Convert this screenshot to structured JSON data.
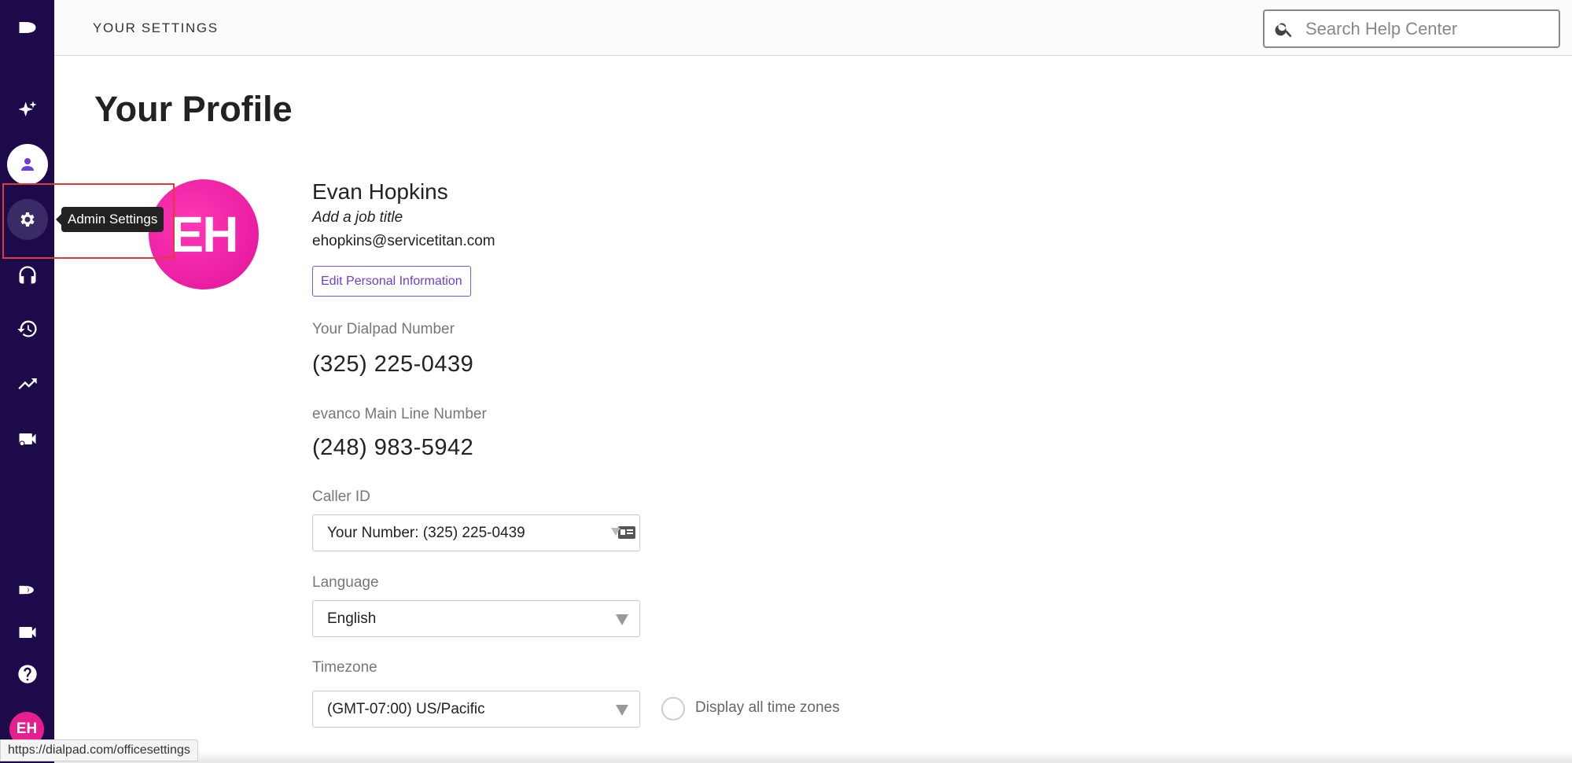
{
  "header": {
    "title": "YOUR SETTINGS",
    "search_placeholder": "Search Help Center"
  },
  "sidebar": {
    "tooltip": "Admin Settings",
    "avatar_initials": "EH",
    "items": [
      "sparkle-icon",
      "person-icon",
      "gear-icon",
      "headset-icon",
      "history-icon",
      "trending-icon",
      "video-icon",
      "dialpad-icon",
      "camera-icon",
      "help-icon"
    ]
  },
  "profile": {
    "page_title": "Your Profile",
    "initials": "EH",
    "name": "Evan Hopkins",
    "job_title_placeholder": "Add a job title",
    "email": "ehopkins@servicetitan.com",
    "edit_button": "Edit Personal Information",
    "dialpad_number_label": "Your Dialpad Number",
    "dialpad_number": "(325) 225-0439",
    "main_line_label": "evanco Main Line Number",
    "main_line_number": "(248) 983-5942",
    "caller_id_label": "Caller ID",
    "caller_id_value": "Your Number: (325) 225-0439",
    "language_label": "Language",
    "language_value": "English",
    "timezone_label": "Timezone",
    "timezone_value": "(GMT-07:00) US/Pacific",
    "display_all_timezones_label": "Display all time zones"
  },
  "status_bar": {
    "url": "https://dialpad.com/officesettings"
  },
  "colors": {
    "sidebar": "#1c0a4a",
    "accent": "#6a3fe0",
    "avatar": "#e61f8f"
  }
}
